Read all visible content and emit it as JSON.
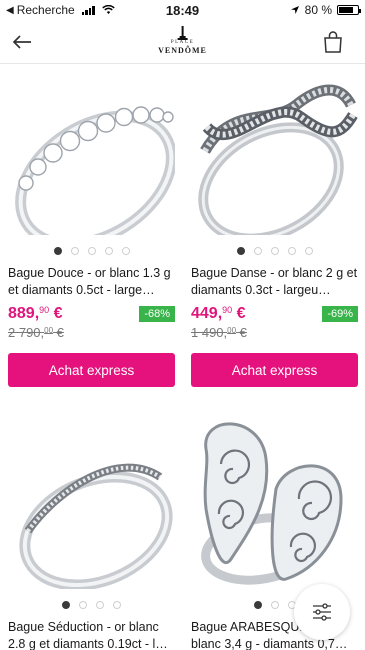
{
  "status_bar": {
    "back_app": "Recherche",
    "time": "18:49",
    "battery": "80 %",
    "battery_level": 0.8
  },
  "header": {
    "logo_top": "PLACE",
    "logo_bottom": "VENDÔME"
  },
  "products": [
    {
      "title": "Bague Douce - or blanc 1.3 g et diamants 0.5ct - large…",
      "price_int": "889,",
      "price_dec": "90",
      "price_cur": " €",
      "discount": "-68%",
      "old_int": "2 790,",
      "old_dec": "00",
      "old_cur": " €",
      "button": "Achat express",
      "image_icon": "eternity-ring-icon"
    },
    {
      "title": "Bague Danse - or blanc 2 g et diamants 0.3ct - largeu…",
      "price_int": "449,",
      "price_dec": "90",
      "price_cur": " €",
      "discount": "-69%",
      "old_int": "1 490,",
      "old_dec": "00",
      "old_cur": " €",
      "button": "Achat express",
      "image_icon": "twisted-ring-icon"
    },
    {
      "title": "Bague Séduction - or blanc 2.8 g et diamants 0.19ct - l…",
      "image_icon": "crossover-ring-icon"
    },
    {
      "title": "Bague ARABESQUE - or blanc 3,4 g - diamants 0,7…",
      "image_icon": "arabesque-ring-icon"
    }
  ]
}
